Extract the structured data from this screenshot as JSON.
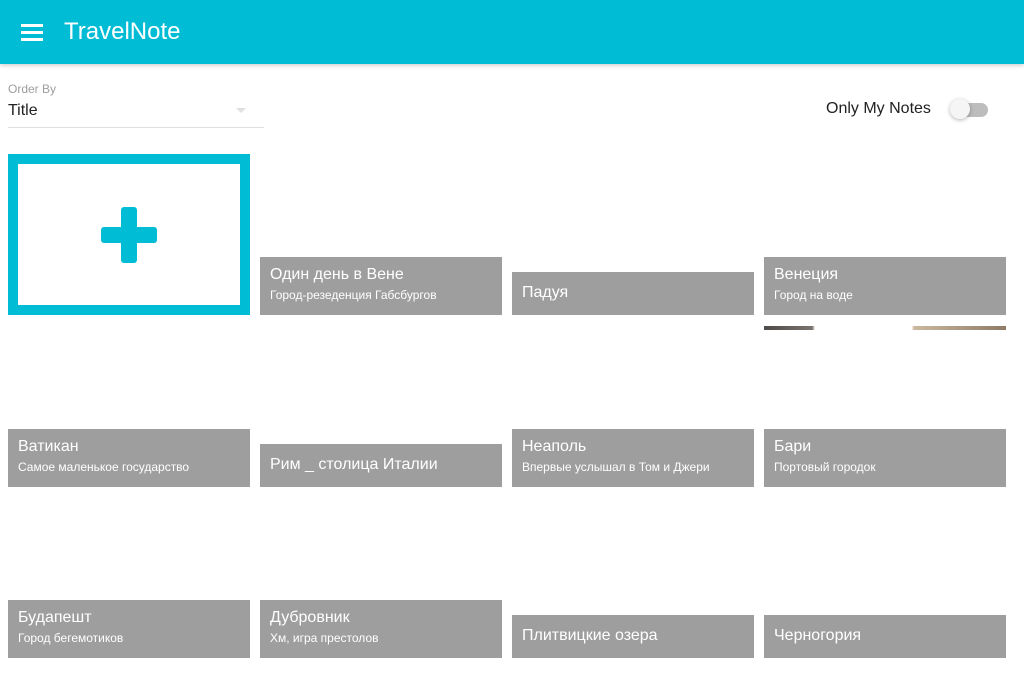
{
  "app": {
    "title": "TravelNote",
    "accent_color": "#00bcd4",
    "caption_bg_color": "#9e9e9e"
  },
  "toolbar": {
    "menu_icon": "hamburger-menu-icon",
    "order_by": {
      "label": "Order By",
      "value": "Title"
    },
    "only_my_notes": {
      "label": "Only My Notes",
      "checked": false
    }
  },
  "add_card": {
    "icon": "plus-icon"
  },
  "notes": [
    {
      "title": "Один день в Вене",
      "subtitle": "Город-резеденция Габсбургов"
    },
    {
      "title": "Падуя",
      "subtitle": ""
    },
    {
      "title": "Венеция",
      "subtitle": "Город на воде"
    },
    {
      "title": "Ватикан",
      "subtitle": "Самое маленькое государство"
    },
    {
      "title": "Рим _ столица Италии",
      "subtitle": ""
    },
    {
      "title": "Неаполь",
      "subtitle": "Впервые услышал в Том и Джери"
    },
    {
      "title": "Бари",
      "subtitle": "Портовый городок"
    },
    {
      "title": "Будапешт",
      "subtitle": "Город бегемотиков"
    },
    {
      "title": "Дубровник",
      "subtitle": "Хм, игра престолов"
    },
    {
      "title": "Плитвицкие озера",
      "subtitle": ""
    },
    {
      "title": "Черногория",
      "subtitle": ""
    }
  ]
}
